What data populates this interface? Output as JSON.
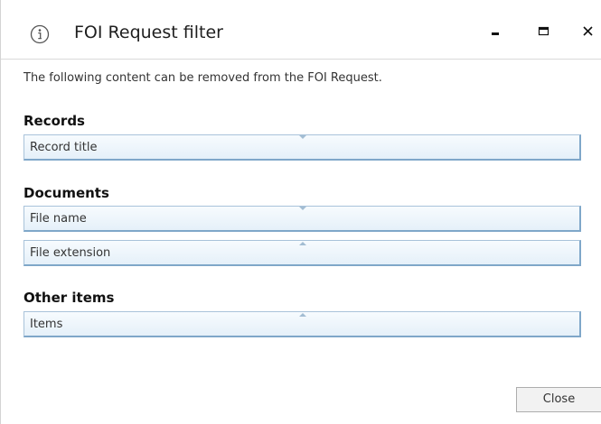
{
  "window": {
    "title": "FOI Request filter",
    "icon": "info-icon",
    "controls": {
      "minimize_icon": "minimize-icon",
      "maximize_icon": "maximize-icon",
      "close_icon": "close-icon"
    }
  },
  "description": "The following content can be removed from the FOI Request.",
  "sections": {
    "records": {
      "heading": "Records",
      "fields": [
        {
          "label": "Record title",
          "chevron": "down"
        }
      ]
    },
    "documents": {
      "heading": "Documents",
      "fields": [
        {
          "label": "File name",
          "chevron": "down"
        },
        {
          "label": "File extension",
          "chevron": "up"
        }
      ]
    },
    "other_items": {
      "heading": "Other items",
      "fields": [
        {
          "label": "Items",
          "chevron": "up"
        }
      ]
    }
  },
  "footer": {
    "close_label": "Close"
  },
  "colors": {
    "field_border": "#7fa7c9",
    "field_fill": "#e5f0f9",
    "chevron": "#a3bdd3"
  }
}
